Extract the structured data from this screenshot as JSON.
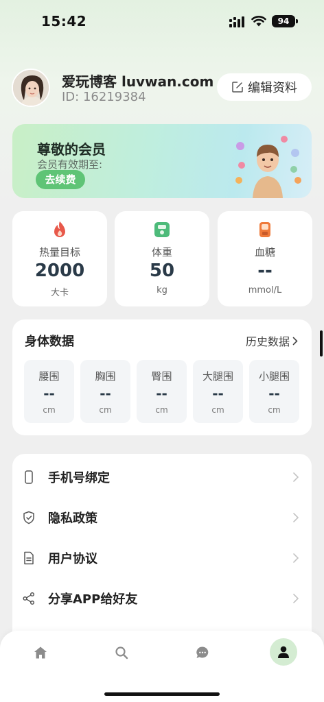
{
  "status_bar": {
    "time": "15:42",
    "battery": "94"
  },
  "profile": {
    "username": "爱玩博客 luvwan.com",
    "user_id": "ID: 16219384",
    "edit_label": "编辑资料"
  },
  "membership": {
    "title": "尊敬的会员",
    "subtitle": "会员有效期至:",
    "renew_label": "去续费"
  },
  "stats": [
    {
      "label": "热量目标",
      "value": "2000",
      "unit": "大卡",
      "icon": "flame-icon",
      "color": "#e8584a"
    },
    {
      "label": "体重",
      "value": "50",
      "unit": "kg",
      "icon": "scale-icon",
      "color": "#4dbb7a"
    },
    {
      "label": "血糖",
      "value": "--",
      "unit": "mmol/L",
      "icon": "blood-sugar-icon",
      "color": "#ef7a3a"
    }
  ],
  "body_data": {
    "title": "身体数据",
    "history_label": "历史数据",
    "measurements": [
      {
        "label": "腰围",
        "value": "--",
        "unit": "cm"
      },
      {
        "label": "胸围",
        "value": "--",
        "unit": "cm"
      },
      {
        "label": "臀围",
        "value": "--",
        "unit": "cm"
      },
      {
        "label": "大腿围",
        "value": "--",
        "unit": "cm"
      },
      {
        "label": "小腿围",
        "value": "--",
        "unit": "cm"
      }
    ]
  },
  "menu": [
    {
      "label": "手机号绑定",
      "icon": "phone-icon"
    },
    {
      "label": "隐私政策",
      "icon": "shield-icon"
    },
    {
      "label": "用户协议",
      "icon": "document-icon"
    },
    {
      "label": "分享APP给好友",
      "icon": "share-icon"
    }
  ],
  "tabbar": {
    "tabs": [
      "home-icon",
      "search-icon",
      "chat-icon",
      "user-icon"
    ],
    "active": "user-icon",
    "accent": "#d4ecd2"
  }
}
